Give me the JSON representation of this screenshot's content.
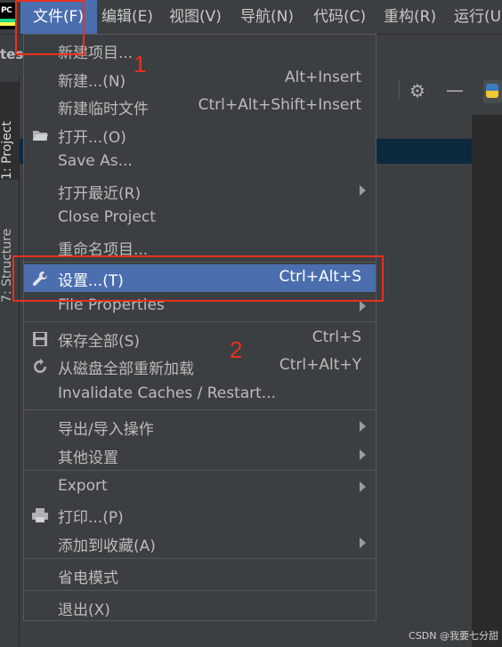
{
  "menubar": {
    "items": [
      "文件(F)",
      "编辑(E)",
      "视图(V)",
      "导航(N)",
      "代码(C)",
      "重构(R)",
      "运行(U"
    ]
  },
  "side_tabs": [
    "1: Project",
    "7: Structure"
  ],
  "project_label": "tes",
  "file_menu": {
    "new_project": "新建项目...",
    "new": {
      "label": "新建...(N)",
      "shortcut": "Alt+Insert"
    },
    "new_scratch": {
      "label": "新建临时文件",
      "shortcut": "Ctrl+Alt+Shift+Insert"
    },
    "open": "打开...(O)",
    "save_as": "Save As...",
    "open_recent": "打开最近(R)",
    "close_project": "Close Project",
    "rename_project": "重命名项目...",
    "settings": {
      "label": "设置...(T)",
      "shortcut": "Ctrl+Alt+S"
    },
    "file_properties": "File Properties",
    "save_all": {
      "label": "保存全部(S)",
      "shortcut": "Ctrl+S"
    },
    "reload_disk": {
      "label": "从磁盘全部重新加载",
      "shortcut": "Ctrl+Alt+Y"
    },
    "invalidate_caches": "Invalidate Caches / Restart...",
    "import_export": "导出/导入操作",
    "other_settings": "其他设置",
    "export": "Export",
    "print": "打印...(P)",
    "add_to_favorites": "添加到收藏(A)",
    "power_save": "省电模式",
    "exit": "退出(X)"
  },
  "annotations": {
    "step1": "1",
    "step2": "2"
  },
  "watermark": "CSDN @我要七分甜",
  "colors": {
    "accent": "#4b6eaf",
    "annotation": "#e8301f",
    "background": "#3c3f41"
  }
}
